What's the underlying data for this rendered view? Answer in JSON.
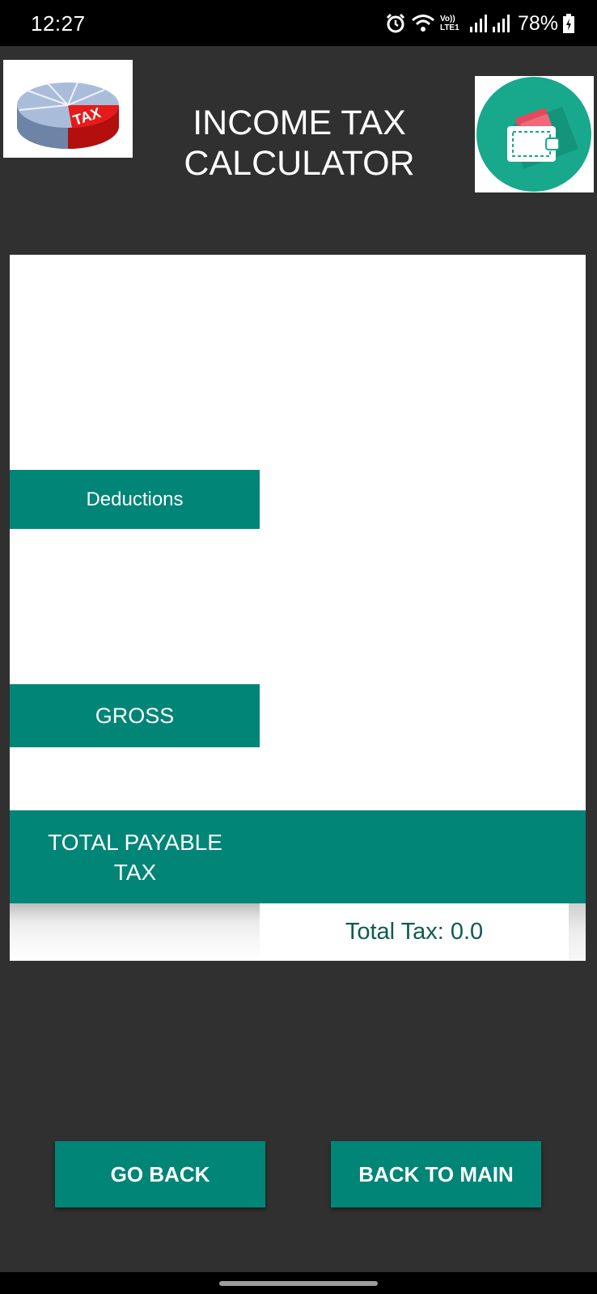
{
  "status_bar": {
    "time": "12:27",
    "network_label": "Vo)) LTE1",
    "battery": "78%",
    "icons": [
      "alarm-icon",
      "wifi-icon",
      "signal-icon",
      "signal-icon",
      "battery-charging-icon"
    ]
  },
  "header": {
    "title_line1": "INCOME TAX",
    "title_line2": "CALCULATOR",
    "left_logo_text": "TAX",
    "left_logo_icon": "tax-pie-chart-icon",
    "right_logo_icon": "wallet-icon"
  },
  "panel": {
    "deductions_label": "Deductions",
    "gross_label": "GROSS",
    "total_payable_label_line1": "TOTAL PAYABLE",
    "total_payable_label_line2": "TAX",
    "total_tax_text": "Total Tax: 0.0"
  },
  "buttons": {
    "go_back": "GO BACK",
    "back_to_main": "BACK TO MAIN"
  },
  "colors": {
    "background": "#303030",
    "accent_teal": "#008577",
    "panel": "#ffffff",
    "total_text": "#0f5a52"
  }
}
